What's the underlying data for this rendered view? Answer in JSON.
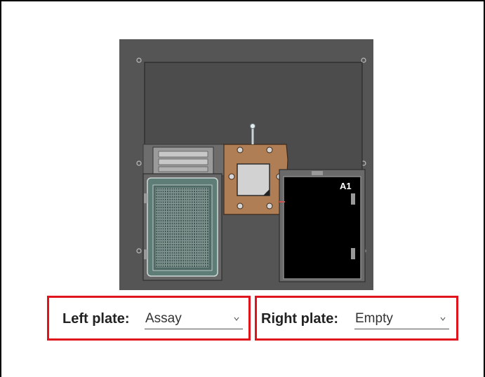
{
  "deck": {
    "well_label": "A1",
    "colors": {
      "background": "#555555",
      "left_plate": "#5e7d77",
      "holder": "#b07e55",
      "right_plate": "#000000"
    }
  },
  "left_plate": {
    "label": "Left plate:",
    "value": "Assay"
  },
  "right_plate": {
    "label": "Right plate:",
    "value": "Empty"
  },
  "accent": "#e0141c",
  "icons": [
    "chevron-down-icon"
  ]
}
